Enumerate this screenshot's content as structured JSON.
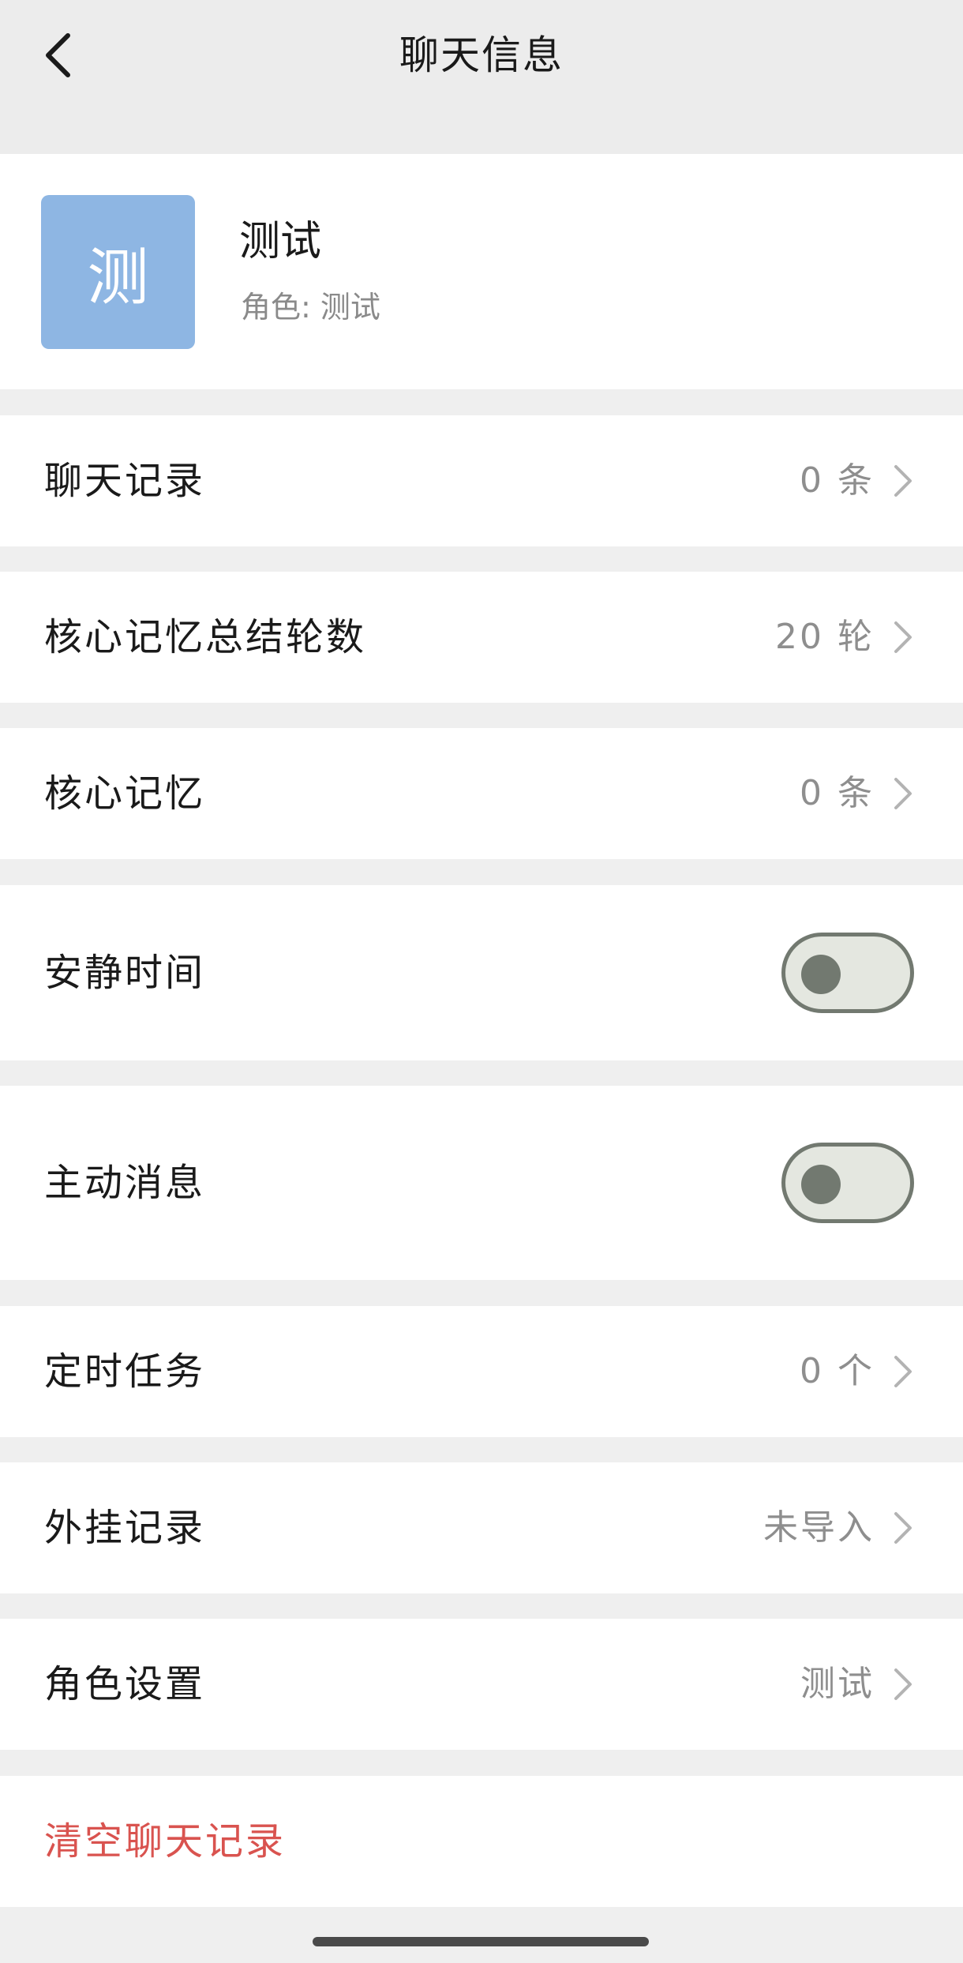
{
  "nav": {
    "title": "聊天信息",
    "back_icon": "chevron-left-icon"
  },
  "profile": {
    "avatar_char": "测",
    "avatar_color": "#8eb6e3",
    "name": "测试",
    "role_label": "角色: 测试"
  },
  "rows": {
    "chat_history": {
      "label": "聊天记录",
      "value": "0 条"
    },
    "summary_rounds": {
      "label": "核心记忆总结轮数",
      "value": "20 轮"
    },
    "core_memory": {
      "label": "核心记忆",
      "value": "0 条"
    },
    "quiet_time": {
      "label": "安静时间",
      "enabled": false
    },
    "proactive_message": {
      "label": "主动消息",
      "enabled": false
    },
    "scheduled_tasks": {
      "label": "定时任务",
      "value": "0 个"
    },
    "external_records": {
      "label": "外挂记录",
      "value": "未导入"
    },
    "role_settings": {
      "label": "角色设置",
      "value": "测试"
    },
    "clear_history": {
      "label": "清空聊天记录"
    }
  },
  "colors": {
    "danger": "#d9534f",
    "toggle_off": "#727970",
    "background": "#efefef"
  }
}
